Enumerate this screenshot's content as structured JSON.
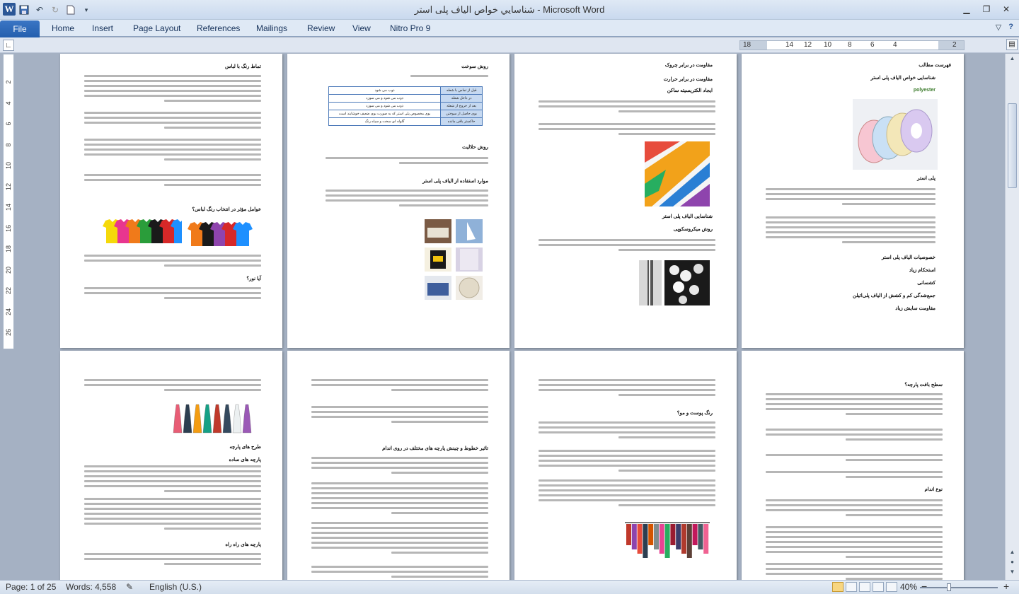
{
  "window": {
    "title": "شناسایي خواص الیاف پلی استر  -  Microsoft Word",
    "app_icon": "W",
    "controls": [
      "minimize",
      "maximize",
      "close"
    ]
  },
  "quick_access": [
    "save-icon",
    "undo-icon",
    "redo-icon",
    "new-document-icon",
    "customize-icon"
  ],
  "ribbon": {
    "file_label": "File",
    "tabs": [
      "Home",
      "Insert",
      "Page Layout",
      "References",
      "Mailings",
      "Review",
      "View",
      "Nitro Pro 9"
    ]
  },
  "ruler": {
    "numbers": [
      "18",
      "14",
      "12",
      "10",
      "8",
      "6",
      "4",
      "2"
    ],
    "vertical_numbers": [
      "2",
      "4",
      "6",
      "8",
      "10",
      "12",
      "14",
      "16",
      "18",
      "20",
      "22",
      "24",
      "26"
    ]
  },
  "pages_row1": [
    {
      "headings": [
        "تماط رنگ با لباس",
        "عوامل مؤثر در انتخاب رنگ لباس؟",
        "آیا نور؟"
      ]
    },
    {
      "headings": [
        "روش سوخت",
        "روش حلالیت",
        "موارد استفاده از الیاف پلی استر"
      ],
      "table": [
        [
          "قبل از تماس با شعله",
          "ذوب می شود"
        ],
        [
          "در داخل شعله",
          "ذوب می شود و می سوزد"
        ],
        [
          "بعد از خروج از شعله",
          "ذوب می شود و می سوزد"
        ],
        [
          "بوی حاصل از سوختن",
          "بوی مخصوص پلی استر که به صورت بوی ضعیف خوشایند است"
        ],
        [
          "خاکستر باقی مانده",
          "گلوله ای سخت و سیاه رنگ"
        ]
      ]
    },
    {
      "headings": [
        "مقاومت در برابر چروک",
        "مقاومت در برابر حرارت",
        "ایجاد الکتریسیته ساکن",
        "شناسایی الیاف پلی استر",
        "روش میکروسکوپی"
      ]
    },
    {
      "headings": [
        "فهرست مطالب",
        "شناسایی خواص الیاف پلی استر",
        "پلی استر",
        "خصوصیات الیاف پلی استر",
        "استحکام زیاد",
        "کشسانی",
        "جمع‌شدگی کم و کشش از الیاف پلی‌اتیلن",
        "مقاومت سایش زیاد"
      ],
      "label_polyester": "polyester"
    }
  ],
  "pages_row2": [
    {
      "headings": [
        "طرح های پارچه",
        "پارچه های ساده",
        "پارچه های راه راه"
      ]
    },
    {
      "headings": [
        "تاثیر خطوط و چینش پارچه های مختلف در روی اندام"
      ]
    },
    {
      "headings": [
        "رنگ پوست و مو؟"
      ]
    },
    {
      "headings": [
        "سطح بافت پارچه؟",
        "نوع اندام"
      ]
    }
  ],
  "status": {
    "page": "Page: 1 of 25",
    "words": "Words: 4,558",
    "language": "English (U.S.)",
    "zoom": "40%",
    "zoom_out": "−",
    "zoom_in": "+"
  },
  "colors": {
    "accent": "#2b5797",
    "file_tab": "#245fae",
    "canvas": "#a5b1c3",
    "table_header": "#c6d9f1"
  }
}
